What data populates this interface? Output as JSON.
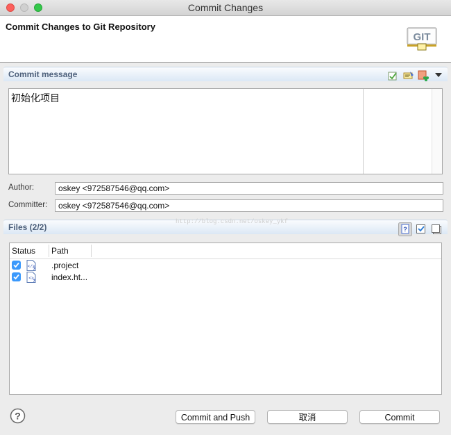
{
  "window": {
    "title": "Commit Changes"
  },
  "header": {
    "title": "Commit Changes to Git Repository",
    "logo_text": "GIT"
  },
  "commit_message": {
    "section_title": "Commit message",
    "text": "初始化项目",
    "toolbar_icons": [
      "spell-check-icon",
      "compare-icon",
      "add-signed-off-icon",
      "dropdown-arrow-icon"
    ]
  },
  "author": {
    "label": "Author:",
    "value": "oskey <972587546@qq.com>"
  },
  "committer": {
    "label": "Committer:",
    "value": "oskey <972587546@qq.com>"
  },
  "watermark": "http://blog.csdn.net/oskey_ykf",
  "files": {
    "section_title": "Files (2/2)",
    "columns": [
      "Status",
      "Path"
    ],
    "rows": [
      {
        "checked": true,
        "icon": "xml-file-icon",
        "path": ".project"
      },
      {
        "checked": true,
        "icon": "html-file-icon",
        "path": "index.ht..."
      }
    ],
    "toolbar_icons": [
      "show-untracked-icon",
      "select-all-icon",
      "deselect-all-icon"
    ]
  },
  "buttons": {
    "commit_push": "Commit and Push",
    "cancel": "取消",
    "commit": "Commit"
  },
  "colors": {
    "checkbox": "#3b99fc",
    "section_bar": "#dbe8f5",
    "section_title": "#4c5f7a"
  }
}
